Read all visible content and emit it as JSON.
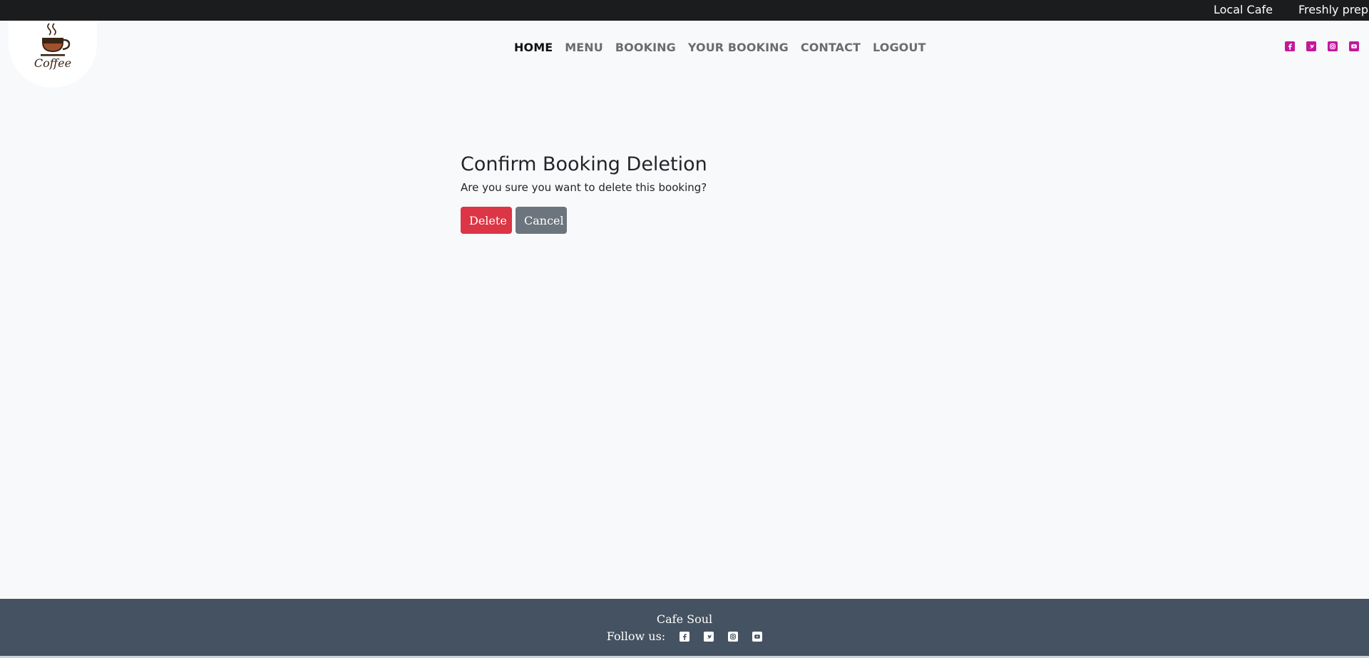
{
  "ticker": {
    "items": [
      "Local Cafe",
      "Freshly prepared"
    ]
  },
  "logo": {
    "text": "Coffee"
  },
  "nav": {
    "items": [
      {
        "label": "HOME",
        "active": true
      },
      {
        "label": "MENU"
      },
      {
        "label": "BOOKING"
      },
      {
        "label": "YOUR BOOKING"
      },
      {
        "label": "CONTACT"
      },
      {
        "label": "LOGOUT"
      }
    ]
  },
  "social": {
    "icons": [
      "facebook-icon",
      "twitter-icon",
      "instagram-icon",
      "youtube-icon"
    ],
    "accent": "#c4189b"
  },
  "main": {
    "title": "Confirm Booking Deletion",
    "message": "Are you sure you want to delete this booking?",
    "delete_label": "Delete",
    "cancel_label": "Cancel"
  },
  "footer": {
    "brand": "Cafe Soul",
    "follow_label": "Follow us:"
  },
  "colors": {
    "danger": "#dc3545",
    "secondary": "#6c757d",
    "footer_bg": "#455261",
    "topbar_bg": "#1b1c1e"
  }
}
